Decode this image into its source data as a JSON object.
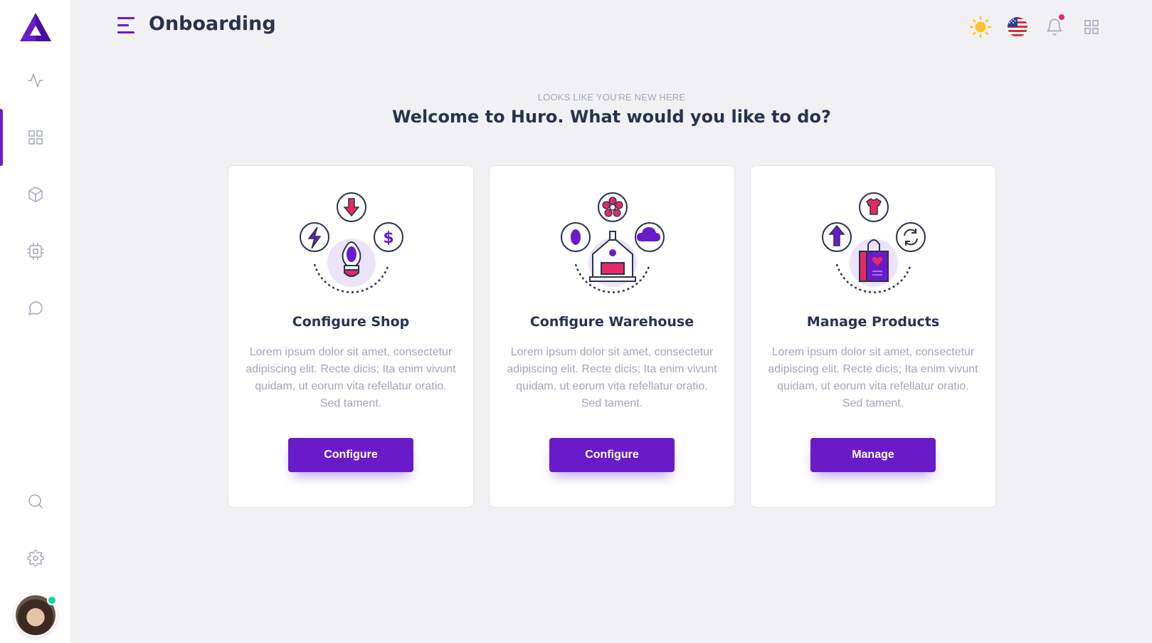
{
  "header": {
    "title": "Onboarding"
  },
  "welcome": {
    "eyebrow": "LOOKS LIKE YOU'RE NEW HERE",
    "heading": "Welcome to Huro. What would you like to do?"
  },
  "sidebar": {
    "items": [
      {
        "name": "activity-icon",
        "active": false
      },
      {
        "name": "grid-icon",
        "active": true
      },
      {
        "name": "box-icon",
        "active": false
      },
      {
        "name": "cpu-icon",
        "active": false
      },
      {
        "name": "chat-icon",
        "active": false
      }
    ],
    "bottom": [
      "search-icon",
      "gear-icon"
    ]
  },
  "cards": [
    {
      "title": "Configure Shop",
      "text": "Lorem ipsum dolor sit amet, consectetur adipiscing elit. Recte dicis; Ita enim vivunt quidam, ut eorum vita refellatur oratio. Sed tament.",
      "button": "Configure"
    },
    {
      "title": "Configure Warehouse",
      "text": "Lorem ipsum dolor sit amet, consectetur adipiscing elit. Recte dicis; Ita enim vivunt quidam, ut eorum vita refellatur oratio. Sed tament.",
      "button": "Configure"
    },
    {
      "title": "Manage Products",
      "text": "Lorem ipsum dolor sit amet, consectetur adipiscing elit. Recte dicis; Ita enim vivunt quidam, ut eorum vita refellatur oratio. Sed tament.",
      "button": "Manage"
    }
  ],
  "colors": {
    "primary": "#6a1bc9",
    "accent_pink": "#e62965",
    "online": "#06d6a0",
    "sun": "#ffc325",
    "muted": "#a2a5b9",
    "heading": "#283252"
  }
}
